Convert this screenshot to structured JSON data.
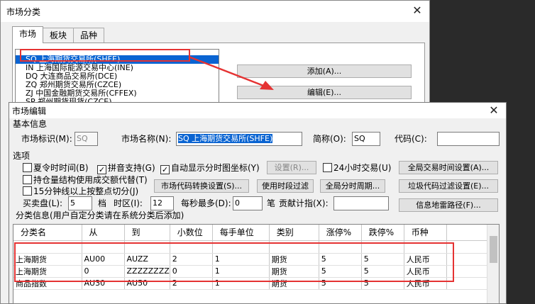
{
  "back_window": {
    "title": "市场分类",
    "close": "✕",
    "tabs": [
      "市场",
      "板块",
      "品种"
    ],
    "list_items": [
      "SQ 上海期货交易所(SHFE)",
      "IN 上海国际能源交易中心(INE)",
      "DQ 大连商品交易所(DCE)",
      "ZQ 郑州期货交易所(CZCE)",
      "ZJ 中国金融期货交易所(CFFEX)",
      "SP 郑州期货现货(CZCE)"
    ],
    "add_button": "添加(A)...",
    "edit_button": "编辑(E)..."
  },
  "dialog": {
    "title": "市场编辑",
    "close": "✕",
    "basic_info": "基本信息",
    "market_id_label": "市场标识(M):",
    "market_id_value": "SQ",
    "market_name_label": "市场名称(N):",
    "market_name_value": "SQ 上海期货交易所(SHFE)",
    "short_name_label": "简称(O):",
    "short_name_value": "SQ",
    "code_label": "代码(C):",
    "code_value": "",
    "options_label": "选项",
    "opt_dst": "夏令时时间(B)",
    "opt_pinyin": "拼音支持(G)",
    "opt_auto_coord": "自动显示分时图坐标(Y)",
    "set_button": "设置(R)...",
    "opt_24h": "24小时交易(U)",
    "global_time_button": "全局交易时间设置(A)...",
    "opt_position": "持仓量结构使用成交额代替(T)",
    "opt_15min": "15分钟线以上按整点切分(J)",
    "code_convert_button": "市场代码转换设置(S)...",
    "time_filter_button": "使用时段过滤",
    "global_period_button": "全局分时周期...",
    "junk_filter_button": "垃圾代码过滤设置(E)...",
    "bidask_label": "买卖盘(L):",
    "bidask_value": "5",
    "bidask_unit": "档",
    "tz_label": "时区(I):",
    "tz_value": "12",
    "max_per_sec_label": "每秒最多(D):",
    "max_per_sec_value": "0",
    "max_per_sec_unit": "笔",
    "contrib_label": "贡献计指(X):",
    "contrib_value": "",
    "mine_path_button": "信息地雷路径(F)...",
    "category_info": "分类信息(用户自定分类请在系统分类后添加)",
    "checked_mark": "✓"
  },
  "table": {
    "headers": [
      "分类名",
      "从",
      "到",
      "小数位",
      "每手单位",
      "类别",
      "涨停%",
      "跌停%",
      "币种"
    ],
    "rows": [
      [
        "上海期货",
        "AU00",
        "AUZZ",
        "2",
        "1",
        "期货",
        "5",
        "5",
        "人民币"
      ],
      [
        "上海期货",
        "0",
        "ZZZZZZZZ",
        "0",
        "1",
        "期货",
        "5",
        "5",
        "人民币"
      ],
      [
        "商品指数",
        "AU30",
        "AU50",
        "2",
        "1",
        "期货",
        "5",
        "5",
        "人民币"
      ]
    ]
  },
  "colors": {
    "highlight": "#e53333",
    "selection": "#0a64d2",
    "arrow": "#e53333"
  }
}
